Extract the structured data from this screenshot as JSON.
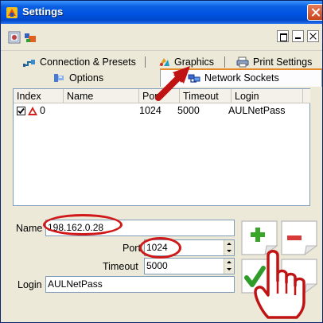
{
  "window": {
    "title": "Settings"
  },
  "tabs": {
    "row1": [
      {
        "label": "Connection & Presets",
        "icon": "connection-icon"
      },
      {
        "label": "Graphics",
        "icon": "graphics-icon"
      },
      {
        "label": "Print Settings",
        "icon": "print-icon"
      }
    ],
    "row2": [
      {
        "label": "Options",
        "icon": "options-icon"
      },
      {
        "label": "Network Sockets",
        "icon": "network-icon",
        "selected": true
      }
    ]
  },
  "grid": {
    "columns": [
      "Index",
      "Name",
      "Port",
      "Timeout",
      "Login"
    ],
    "rows": [
      {
        "index": "0",
        "name": "",
        "port": "1024",
        "timeout": "5000",
        "login": "AULNetPass",
        "checked": true
      }
    ]
  },
  "form": {
    "name_label": "Name",
    "name_value": "198.162.0.28",
    "port_label": "Port",
    "port_value": "1024",
    "timeout_label": "Timeout",
    "timeout_value": "5000",
    "login_label": "Login",
    "login_value": "AULNetPass"
  },
  "colors": {
    "highlight": "#d01818",
    "titlebar": "#0054e3",
    "add": "#3aa52a",
    "remove": "#d83a3a",
    "confirm": "#2f9c2a"
  }
}
